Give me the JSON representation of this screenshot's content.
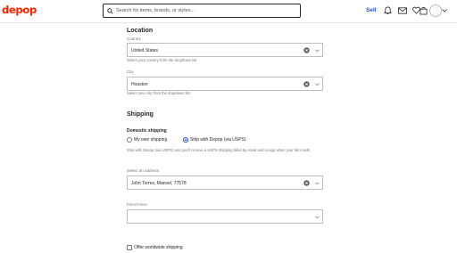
{
  "header": {
    "logo": "depop",
    "search_placeholder": "Search for items, brands, or styles...",
    "sell_label": "Sell",
    "icons": [
      "bell-icon",
      "mail-icon",
      "heart-icon",
      "bag-icon",
      "avatar",
      "chevron-down-icon"
    ]
  },
  "location": {
    "title": "Location",
    "country_label": "Country",
    "country_value": "United States",
    "country_hint": "Select your country from the dropdown list",
    "city_label": "City",
    "city_value": "Houston",
    "city_hint": "Select your city from the dropdown list"
  },
  "shipping": {
    "title": "Shipping",
    "domestic_title": "Domestic shipping",
    "option_own": "My own shipping",
    "option_depop": "Ship with Depop (via USPS)",
    "selected": "Ship with Depop (via USPS)",
    "description": "Ship with Depop (via USPS) and you'll receive a USPS shipping label by email and in-app when your item sells",
    "address_label": "Select an address",
    "address_value": "John Torres, Manvel, 77578",
    "parcel_label": "Parcel Size",
    "parcel_value": "",
    "worldwide_label": "Offer worldwide shipping",
    "worldwide_checked": false
  },
  "colors": {
    "brand": "#ff2300",
    "accent": "#1b4fd8"
  }
}
